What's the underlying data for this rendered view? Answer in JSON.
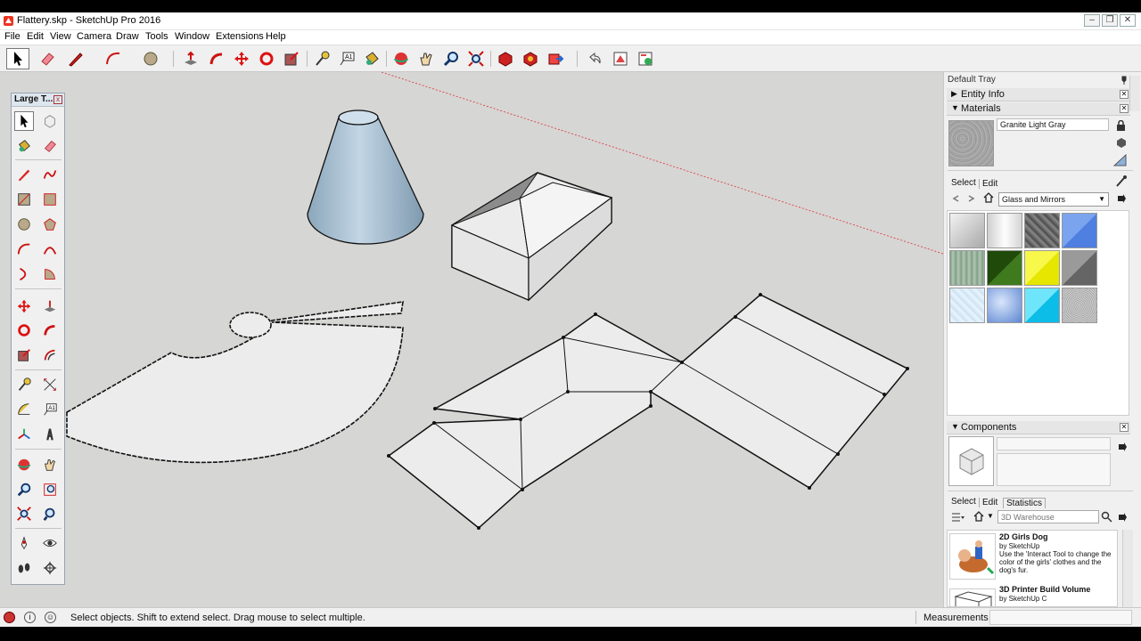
{
  "window": {
    "title": "Flattery.skp - SketchUp Pro 2016",
    "buttons": {
      "minimize": "–",
      "maximize": "❐",
      "close": "✕"
    }
  },
  "menu": [
    "File",
    "Edit",
    "View",
    "Camera",
    "Draw",
    "Tools",
    "Window",
    "Extensions",
    "Help"
  ],
  "toolbar_icons": [
    "select-icon",
    "eraser-icon",
    "pencil-icon",
    "arc-icon",
    "circle-icon",
    "push-pull-icon",
    "follow-me-icon",
    "move-icon",
    "rotate-icon",
    "scale-icon",
    "tape-measure-icon",
    "text-icon",
    "paint-bucket-icon",
    "orbit-icon",
    "pan-icon",
    "zoom-icon",
    "zoom-extents-icon",
    "3d-warehouse-icon",
    "extension-warehouse-icon",
    "send-to-layout-icon",
    "undo-icon",
    "flattery-icon-1",
    "flattery-icon-2"
  ],
  "large_toolset": {
    "title": "Large T...",
    "close": "x"
  },
  "tray": {
    "title": "Default Tray",
    "entity_info": "Entity Info",
    "materials": {
      "header": "Materials",
      "material_name": "Granite Light Gray",
      "tabs": {
        "select": "Select",
        "edit": "Edit"
      },
      "library": "Glass and Mirrors",
      "swatch_colors": [
        "#c9c9c9",
        "#e9e9e9",
        "#6b6b6b",
        "#5f8ff0",
        "#8aa58e",
        "#2e5d12",
        "#f4f41a",
        "#808080",
        "#d6eaf7",
        "#7b9fd8",
        "#22d3f3",
        "#b9b9b9"
      ]
    },
    "components": {
      "header": "Components",
      "tabs": {
        "select": "Select",
        "edit": "Edit",
        "statistics": "Statistics"
      },
      "search_placeholder": "3D Warehouse",
      "results": [
        {
          "title": "2D Girls Dog",
          "author": "by SketchUp",
          "desc": "Use the 'Interact Tool to change the color of the girls' clothes and the dog's fur."
        },
        {
          "title": "3D Printer Build Volume",
          "author": "by SketchUp C",
          "desc": ""
        }
      ]
    }
  },
  "status": {
    "message": "Select objects. Shift to extend select. Drag mouse to select multiple.",
    "measurements": "Measurements"
  },
  "colors": {
    "viewport_bg": "#d6d6d5",
    "face": "#ebebeb",
    "cone_fill": "#a7bfd2",
    "accent": "#5f8ff0"
  }
}
